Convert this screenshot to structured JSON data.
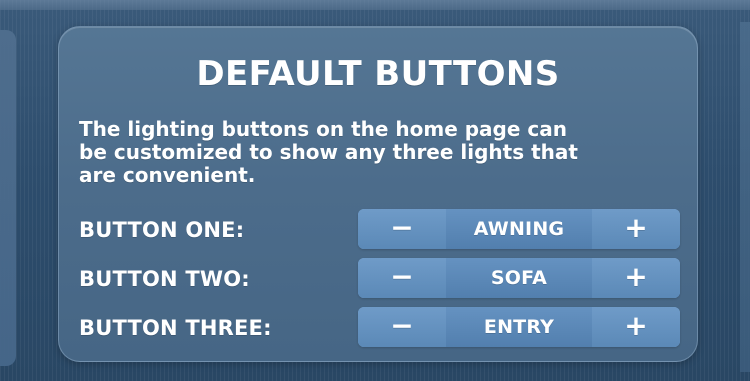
{
  "panel": {
    "title": "DEFAULT BUTTONS",
    "description": "The lighting buttons on the home page can\nbe customized to show any three lights that\nare convenient."
  },
  "settings": [
    {
      "label": "BUTTON ONE:",
      "value": "AWNING",
      "decrement_symbol": "−",
      "increment_symbol": "+"
    },
    {
      "label": "BUTTON TWO:",
      "value": "SOFA",
      "decrement_symbol": "−",
      "increment_symbol": "+"
    },
    {
      "label": "BUTTON THREE:",
      "value": "ENTRY",
      "decrement_symbol": "−",
      "increment_symbol": "+"
    }
  ],
  "icons": {
    "decrement": "minus-icon",
    "increment": "plus-icon"
  }
}
